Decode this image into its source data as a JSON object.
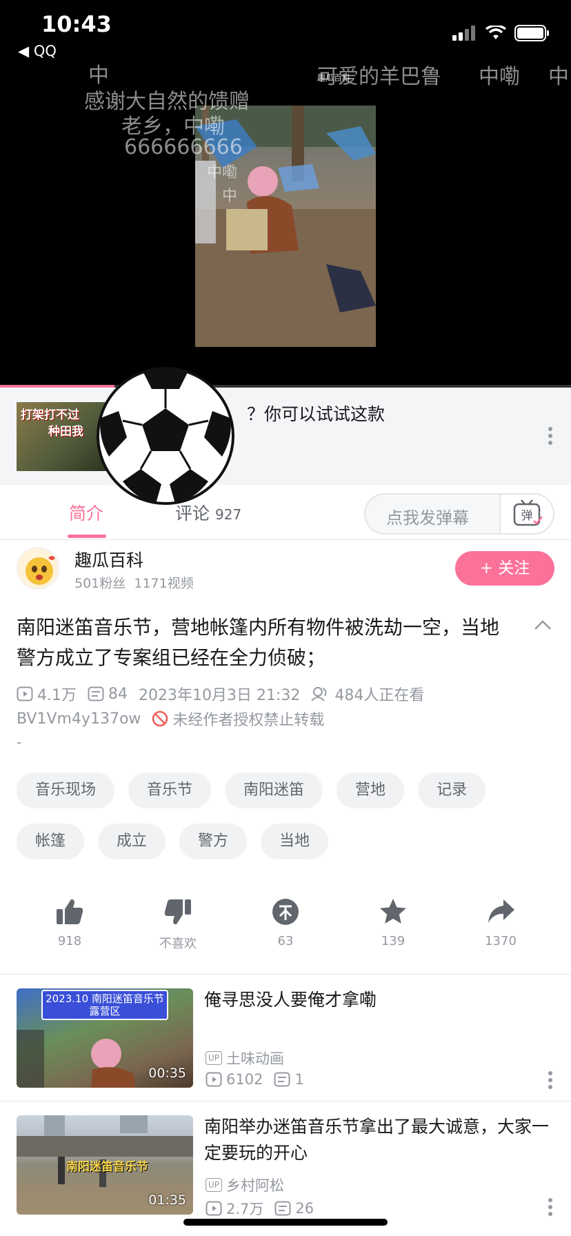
{
  "status_bar": {
    "time": "10:43",
    "back_app": "QQ"
  },
  "video": {
    "danmaku": [
      "中",
      "感谢大自然的馈赠",
      "老乡，中嘞",
      "666666666",
      "中嘞",
      "中",
      "可爱的羊巴鲁",
      "中嘞",
      "中"
    ],
    "watermark": "趣瓜百科",
    "progress_fraction": 0.2
  },
  "ad": {
    "thumb_text_1": "打架打不过",
    "thumb_text_2": "种田我",
    "text": "？你可以试试这款"
  },
  "tabs": {
    "intro": "简介",
    "comments": "评论",
    "comments_count": "927",
    "danmaku_placeholder": "点我发弹幕",
    "danmaku_btn": "弹"
  },
  "uploader": {
    "name": "趣瓜百科",
    "fans": "501粉丝",
    "videos": "1171视频",
    "follow": "+ 关注"
  },
  "video_info": {
    "title": "南阳迷笛音乐节，营地帐篷内所有物件被洗劫一空，当地警方成立了专案组已经在全力侦破；",
    "views": "4.1万",
    "danmaku_count": "84",
    "date": "2023年10月3日 21:32",
    "watching": "484人正在看",
    "bvid": "BV1Vm4y137ow",
    "copyright": "未经作者授权禁止转载",
    "desc": "-"
  },
  "tags": [
    "音乐现场",
    "音乐节",
    "南阳迷笛",
    "营地",
    "记录",
    "帐篷",
    "成立",
    "警方",
    "当地"
  ],
  "actions": {
    "like": "918",
    "dislike": "不喜欢",
    "coin": "63",
    "favorite": "139",
    "share": "1370"
  },
  "recommendations": [
    {
      "title": "俺寻思没人要俺才拿嘞",
      "thumb_text": "2023.10 南阳迷笛音乐节露营区",
      "duration": "00:35",
      "author": "土味动画",
      "views": "6102",
      "danmaku": "1"
    },
    {
      "title": "南阳举办迷笛音乐节拿出了最大诚意，大家一定要玩的开心",
      "thumb_text": "南阳迷笛音乐节",
      "duration": "01:35",
      "author": "乡村阿松",
      "views": "2.7万",
      "danmaku": "26"
    }
  ],
  "colors": {
    "accent": "#fb7299",
    "muted": "#9499a0"
  }
}
